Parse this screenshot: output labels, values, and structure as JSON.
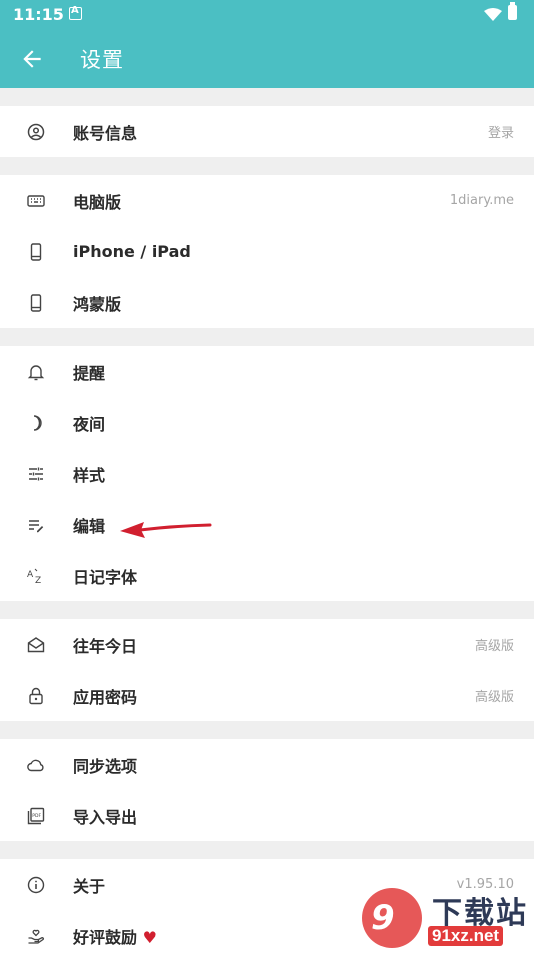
{
  "status_bar": {
    "time": "11:15"
  },
  "app_bar": {
    "title": "设置"
  },
  "groups": [
    [
      {
        "label": "账号信息",
        "value": "登录"
      }
    ],
    [
      {
        "label": "电脑版",
        "value": "1diary.me"
      },
      {
        "label": "iPhone / iPad",
        "value": ""
      },
      {
        "label": "鸿蒙版",
        "value": ""
      }
    ],
    [
      {
        "label": "提醒",
        "value": ""
      },
      {
        "label": "夜间",
        "value": ""
      },
      {
        "label": "样式",
        "value": ""
      },
      {
        "label": "编辑",
        "value": ""
      },
      {
        "label": "日记字体",
        "value": ""
      }
    ],
    [
      {
        "label": "往年今日",
        "value": "高级版"
      },
      {
        "label": "应用密码",
        "value": "高级版"
      }
    ],
    [
      {
        "label": "同步选项",
        "value": ""
      },
      {
        "label": "导入导出",
        "value": ""
      }
    ],
    [
      {
        "label": "关于",
        "value": "v1.95.10"
      },
      {
        "label": "好评鼓励",
        "value": "",
        "suffix": "♥"
      }
    ]
  ],
  "watermark": {
    "logo_text": "9",
    "brand": "下载站",
    "url": "91xz.net"
  },
  "colors": {
    "accent": "#4bbfc3",
    "arrow": "#d11f2f"
  }
}
